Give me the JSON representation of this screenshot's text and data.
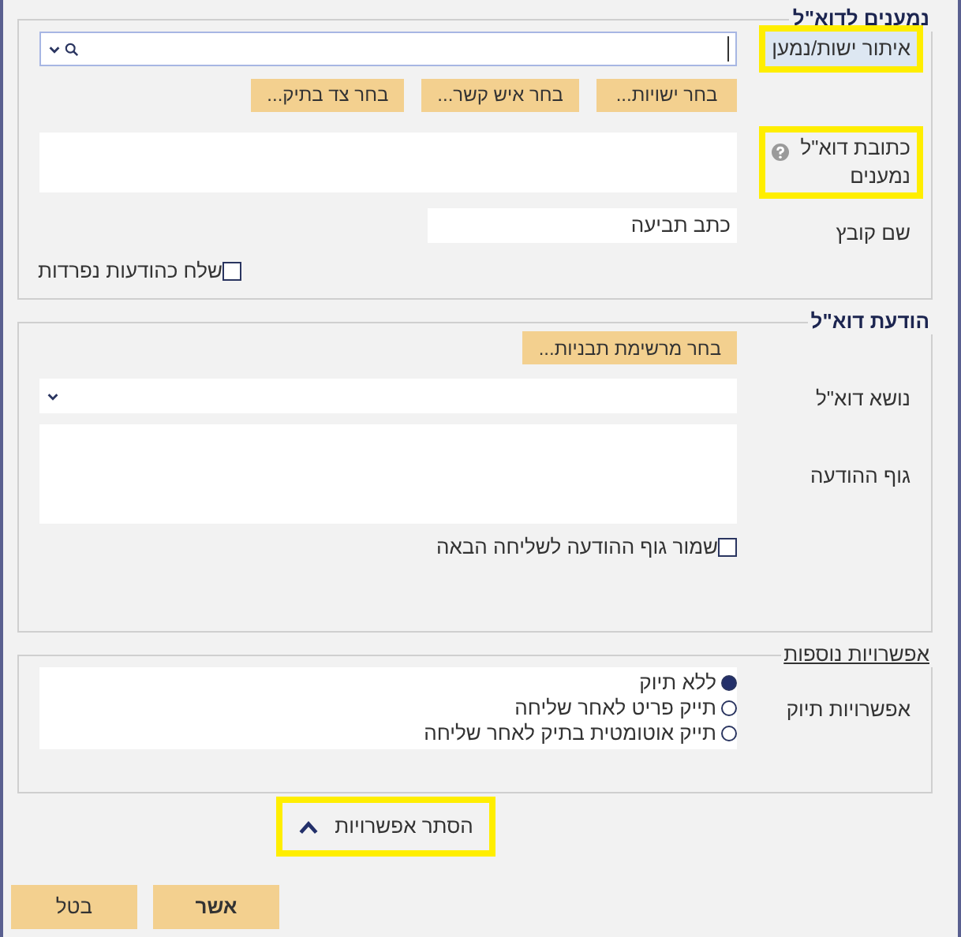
{
  "sections": [
    {
      "legend": "נמענים לדוא\"ל",
      "underlined": false,
      "rows": [
        {
          "kind": "search",
          "label": "איתור ישות/נמען",
          "highlighted": true
        },
        {
          "kind": "buttons",
          "buttons": [
            "בחר ישויות...",
            "בחר איש קשר...",
            "בחר צד בתיק..."
          ]
        },
        {
          "kind": "textarea",
          "label": "כתובת דוא\"ל נמענים",
          "help": true,
          "highlighted": true
        },
        {
          "kind": "text",
          "label": "שם קובץ",
          "value": "כתב תביעה"
        },
        {
          "kind": "checkbox",
          "label": "שלח כהודעות נפרדות",
          "checked": false,
          "full_width": true
        }
      ]
    },
    {
      "legend": "הודעת דוא\"ל",
      "underlined": false,
      "rows": [
        {
          "kind": "buttons",
          "buttons": [
            "בחר מרשימת תבניות..."
          ]
        },
        {
          "kind": "select",
          "label": "נושא דוא\"ל"
        },
        {
          "kind": "body",
          "label": "גוף ההודעה"
        },
        {
          "kind": "checkbox",
          "label": "שמור גוף ההודעה לשליחה הבאה",
          "checked": false,
          "full_width": false
        }
      ]
    },
    {
      "legend": "אפשרויות נוספות",
      "underlined": true,
      "rows": [
        {
          "kind": "radios",
          "label": "אפשרויות תיוק",
          "options": [
            {
              "label": "ללא תיוק",
              "selected": true
            },
            {
              "label": "תייק פריט לאחר שליחה",
              "selected": false
            },
            {
              "label": "תייק אוטומטית בתיק לאחר שליחה",
              "selected": false
            }
          ]
        }
      ]
    }
  ],
  "toggle": {
    "label": "הסתר אפשרויות",
    "expanded": true,
    "highlighted": true
  },
  "buttons": [
    "אשר",
    "בטל"
  ]
}
